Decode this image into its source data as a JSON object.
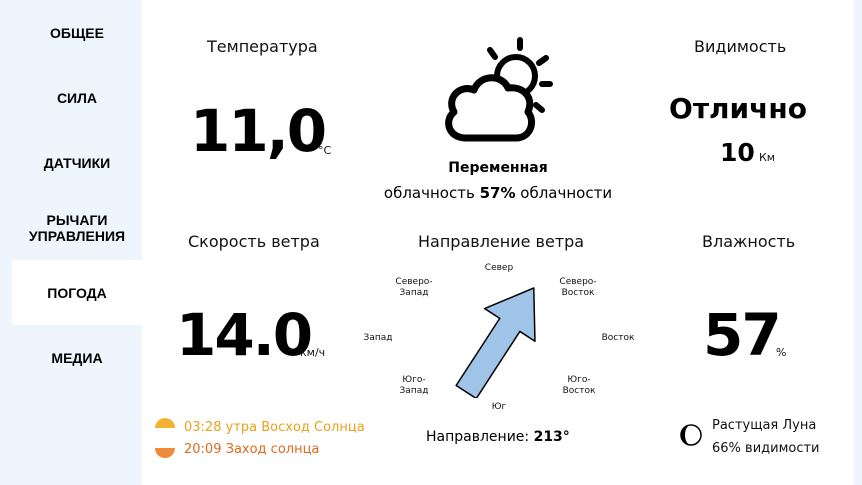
{
  "sidebar": {
    "items": [
      {
        "label": "ОБЩЕЕ",
        "active": false
      },
      {
        "label": "СИЛА",
        "active": false
      },
      {
        "label": "ДАТЧИКИ",
        "active": false
      },
      {
        "label": "РЫЧАГИ УПРАВЛЕНИЯ",
        "active": false
      },
      {
        "label": "ПОГОДА",
        "active": true
      },
      {
        "label": "МЕДИА",
        "active": false
      }
    ]
  },
  "temperature": {
    "label": "Температура",
    "value": "11,0",
    "unit": "°C"
  },
  "condition": {
    "icon": "partly-cloudy-icon",
    "title": "Переменная",
    "cloud_prefix": "облачность",
    "cloud_value": "57%",
    "cloud_suffix": "облачности"
  },
  "visibility": {
    "label": "Видимость",
    "value": "Отлично",
    "distance": "10",
    "unit": "Км"
  },
  "wind_speed": {
    "label": "Скорость ветра",
    "value": "14.0",
    "unit": "км/ч"
  },
  "wind_direction": {
    "label": "Направление ветра",
    "degrees": 213,
    "readout_prefix": "Направление:",
    "readout_value": "213°",
    "compass": {
      "n": "Север",
      "ne": "Северо-\nВосток",
      "e": "Восток",
      "se": "Юго-\nВосток",
      "s": "Юг",
      "sw": "Юго-\nЗапад",
      "w": "Запад",
      "nw": "Северо-\nЗапад"
    },
    "arrow_color": "#9fc4e8"
  },
  "humidity": {
    "label": "Влажность",
    "value": "57",
    "unit": "%"
  },
  "sun": {
    "sunrise_time": "03:28 утра",
    "sunrise_label": "Восход Солнца",
    "sunset_time": "20:09",
    "sunset_label": "Заход солнца",
    "sunrise_color": "#e8a21a",
    "sunset_color": "#e06a1a"
  },
  "moon": {
    "phase": "Растущая Луна",
    "visibility": "66% видимости"
  }
}
